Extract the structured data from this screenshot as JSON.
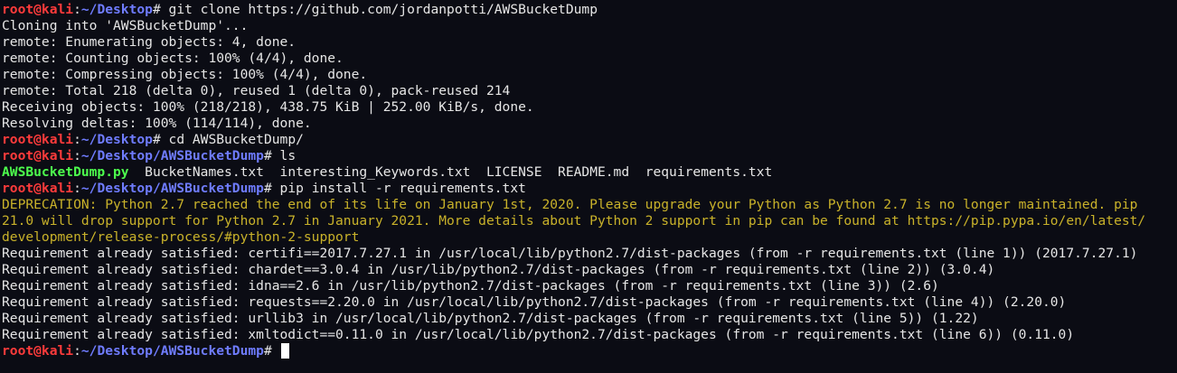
{
  "prompt_user": "root@kali",
  "prompt_colon": ":",
  "prompt_hash": "# ",
  "colors": {
    "background": "#0b0c14",
    "user": "#ff3b3b",
    "path": "#6f7cff",
    "text": "#e6e6e6",
    "executable": "#4dff4d",
    "warning": "#c9b22a"
  },
  "lines": [
    {
      "type": "prompt",
      "path": "~/Desktop",
      "cmd": "git clone https://github.com/jordanpotti/AWSBucketDump"
    },
    {
      "type": "output",
      "text": "Cloning into 'AWSBucketDump'..."
    },
    {
      "type": "output",
      "text": "remote: Enumerating objects: 4, done."
    },
    {
      "type": "output",
      "text": "remote: Counting objects: 100% (4/4), done."
    },
    {
      "type": "output",
      "text": "remote: Compressing objects: 100% (4/4), done."
    },
    {
      "type": "output",
      "text": "remote: Total 218 (delta 0), reused 1 (delta 0), pack-reused 214"
    },
    {
      "type": "output",
      "text": "Receiving objects: 100% (218/218), 438.75 KiB | 252.00 KiB/s, done."
    },
    {
      "type": "output",
      "text": "Resolving deltas: 100% (114/114), done."
    },
    {
      "type": "prompt",
      "path": "~/Desktop",
      "cmd": "cd AWSBucketDump/"
    },
    {
      "type": "prompt",
      "path": "~/Desktop/AWSBucketDump",
      "cmd": "ls"
    },
    {
      "type": "listing",
      "exec": "AWSBucketDump.py",
      "rest": "  BucketNames.txt  interesting_Keywords.txt  LICENSE  README.md  requirements.txt"
    },
    {
      "type": "prompt",
      "path": "~/Desktop/AWSBucketDump",
      "cmd": "pip install -r requirements.txt"
    },
    {
      "type": "warning",
      "text": "DEPRECATION: Python 2.7 reached the end of its life on January 1st, 2020. Please upgrade your Python as Python 2.7 is no longer maintained. pip"
    },
    {
      "type": "warning",
      "text": "21.0 will drop support for Python 2.7 in January 2021. More details about Python 2 support in pip can be found at https://pip.pypa.io/en/latest/"
    },
    {
      "type": "warning",
      "text": "development/release-process/#python-2-support"
    },
    {
      "type": "output",
      "text": "Requirement already satisfied: certifi==2017.7.27.1 in /usr/local/lib/python2.7/dist-packages (from -r requirements.txt (line 1)) (2017.7.27.1)"
    },
    {
      "type": "output",
      "text": "Requirement already satisfied: chardet==3.0.4 in /usr/lib/python2.7/dist-packages (from -r requirements.txt (line 2)) (3.0.4)"
    },
    {
      "type": "output",
      "text": "Requirement already satisfied: idna==2.6 in /usr/lib/python2.7/dist-packages (from -r requirements.txt (line 3)) (2.6)"
    },
    {
      "type": "output",
      "text": "Requirement already satisfied: requests==2.20.0 in /usr/local/lib/python2.7/dist-packages (from -r requirements.txt (line 4)) (2.20.0)"
    },
    {
      "type": "output",
      "text": "Requirement already satisfied: urllib3 in /usr/local/lib/python2.7/dist-packages (from -r requirements.txt (line 5)) (1.22)"
    },
    {
      "type": "output",
      "text": "Requirement already satisfied: xmltodict==0.11.0 in /usr/local/lib/python2.7/dist-packages (from -r requirements.txt (line 6)) (0.11.0)"
    },
    {
      "type": "prompt",
      "path": "~/Desktop/AWSBucketDump",
      "cmd": "",
      "cursor": true
    }
  ]
}
